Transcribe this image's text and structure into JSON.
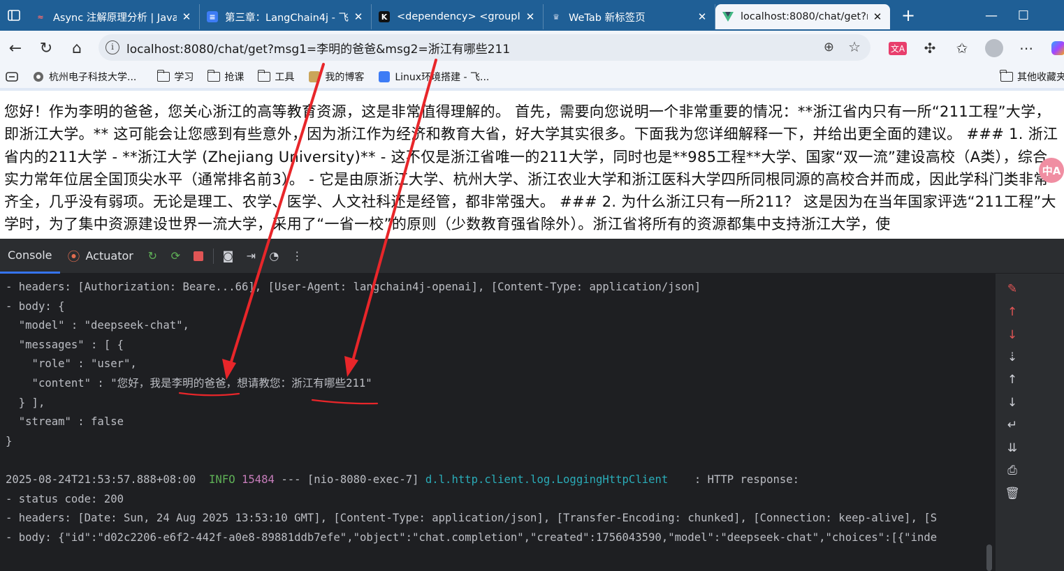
{
  "tabs": [
    {
      "title": "Async 注解原理分析 | Java",
      "icon": "red-fish-icon"
    },
    {
      "title": "第三章：LangChain4j - 飞",
      "icon": "doc-icon"
    },
    {
      "title": "<dependency> <groupId",
      "icon": "k-icon"
    },
    {
      "title": "WeTab 新标签页",
      "icon": "crown-icon"
    },
    {
      "title": "localhost:8080/chat/get?m",
      "icon": "vue-icon",
      "active": true
    }
  ],
  "address": {
    "url": "localhost:8080/chat/get?msg1=李明的爸爸&msg2=浙江有哪些211"
  },
  "bookmarks": [
    {
      "label": "杭州电子科技大学...",
      "icon": "globe-icon"
    },
    {
      "label": "学习",
      "icon": "folder-icon"
    },
    {
      "label": "抢课",
      "icon": "folder-icon"
    },
    {
      "label": "工具",
      "icon": "folder-icon"
    },
    {
      "label": "我的博客",
      "icon": "blog-icon"
    },
    {
      "label": "Linux环境搭建 - 飞...",
      "icon": "feishu-icon"
    },
    {
      "label": "其他收藏夹",
      "icon": "folder-icon"
    }
  ],
  "page": {
    "text": "您好！作为李明的爸爸，您关心浙江的高等教育资源，这是非常值得理解的。 首先，需要向您说明一个非常重要的情况：**浙江省内只有一所“211工程”大学，即浙江大学。** 这可能会让您感到有些意外，因为浙江作为经济和教育大省，好大学其实很多。下面我为您详细解释一下，并给出更全面的建议。 ### 1. 浙江省内的211大学 - **浙江大学 (Zhejiang University)** - 这不仅是浙江省唯一的211大学，同时也是**985工程**大学、国家“双一流”建设高校（A类），综合实力常年位居全国顶尖水平（通常排名前3）。 - 它是由原浙江大学、杭州大学、浙江农业大学和浙江医科大学四所同根同源的高校合并而成，因此学科门类非常齐全，几乎没有弱项。无论是理工、农学、医学、人文社科还是经管，都非常强大。 ### 2. 为什么浙江只有一所211？ 这是因为在当年国家评选“211工程”大学时，为了集中资源建设世界一流大学，采用了“一省一校”的原则（少数教育强省除外）。浙江省将所有的资源都集中支持浙江大学，使",
    "badge": "中A"
  },
  "ide": {
    "tabs": [
      {
        "label": "Console",
        "active": true
      },
      {
        "label": "Actuator",
        "active": false
      }
    ]
  },
  "console": {
    "request_lines": [
      "- headers: [Authorization: Beare...66], [User-Agent: langchain4j-openai], [Content-Type: application/json]",
      "- body: {",
      "  \"model\" : \"deepseek-chat\",",
      "  \"messages\" : [ {",
      "    \"role\" : \"user\",",
      "    \"content\" : \"您好，我是李明的爸爸，想请教您：浙江有哪些211\"",
      "  } ],",
      "  \"stream\" : false",
      "}",
      ""
    ],
    "log": {
      "timestamp": "2025-08-24T21:53:57.888+08:00",
      "level": "INFO",
      "pid": "15484",
      "thread": "--- [nio-8080-exec-7]",
      "logger": "d.l.http.client.log.LoggingHttpClient",
      "message": "   : HTTP response:"
    },
    "response_lines": [
      "- status code: 200",
      "- headers: [Date: Sun, 24 Aug 2025 13:53:10 GMT], [Content-Type: application/json], [Transfer-Encoding: chunked], [Connection: keep-alive], [S",
      "- body: {\"id\":\"d02c2206-e6f2-442f-a0e8-89881ddb7efe\",\"object\":\"chat.completion\",\"created\":1756043590,\"model\":\"deepseek-chat\",\"choices\":[{\"inde"
    ]
  },
  "colors": {
    "tabbar": "#1f5f96",
    "console_bg": "#1e1f22",
    "annotation": "#e8262a",
    "info": "#5fb157",
    "pid": "#c77dbb",
    "logger": "#2aacb8"
  }
}
